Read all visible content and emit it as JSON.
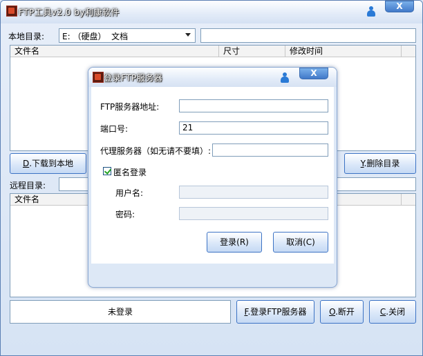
{
  "window": {
    "title": "FTP工具v2.0 by利康软件",
    "close_label": "X"
  },
  "local": {
    "dir_label": "本地目录:",
    "drive_value": "E: （硬盘）  文档",
    "path_value": "",
    "columns": [
      "文件名",
      "尺寸",
      "修改时间"
    ]
  },
  "local_buttons": {
    "download_hotkey": "D",
    "download_label": ".下载到本地",
    "delete_hotkey": "Y",
    "delete_label": ".删除目录"
  },
  "remote": {
    "dir_label": "远程目录:",
    "columns": [
      "文件名"
    ]
  },
  "bottom": {
    "status": "未登录",
    "login_hotkey": "F",
    "login_label": ".登录FTP服务器",
    "disconnect_hotkey": "O",
    "disconnect_label": ".断开",
    "close_hotkey": "C",
    "close_label": ".关闭"
  },
  "dialog": {
    "title": "登录FTP服务器",
    "close_label": "X",
    "server_label": "FTP服务器地址:",
    "server_value": "",
    "port_label": "端口号:",
    "port_value": "21",
    "proxy_label": "代理服务器（如无请不要填）:",
    "proxy_value": "",
    "anonymous_label": "匿名登录",
    "anonymous_checked": true,
    "user_label": "用户名:",
    "user_value": "",
    "password_label": "密码:",
    "password_value": "",
    "login_button": "登录(R)",
    "cancel_button": "取消(C)"
  },
  "colors": {
    "accent": "#3b72c4",
    "window_bg": "#dfe8f6",
    "checkmark": "#21a121"
  }
}
